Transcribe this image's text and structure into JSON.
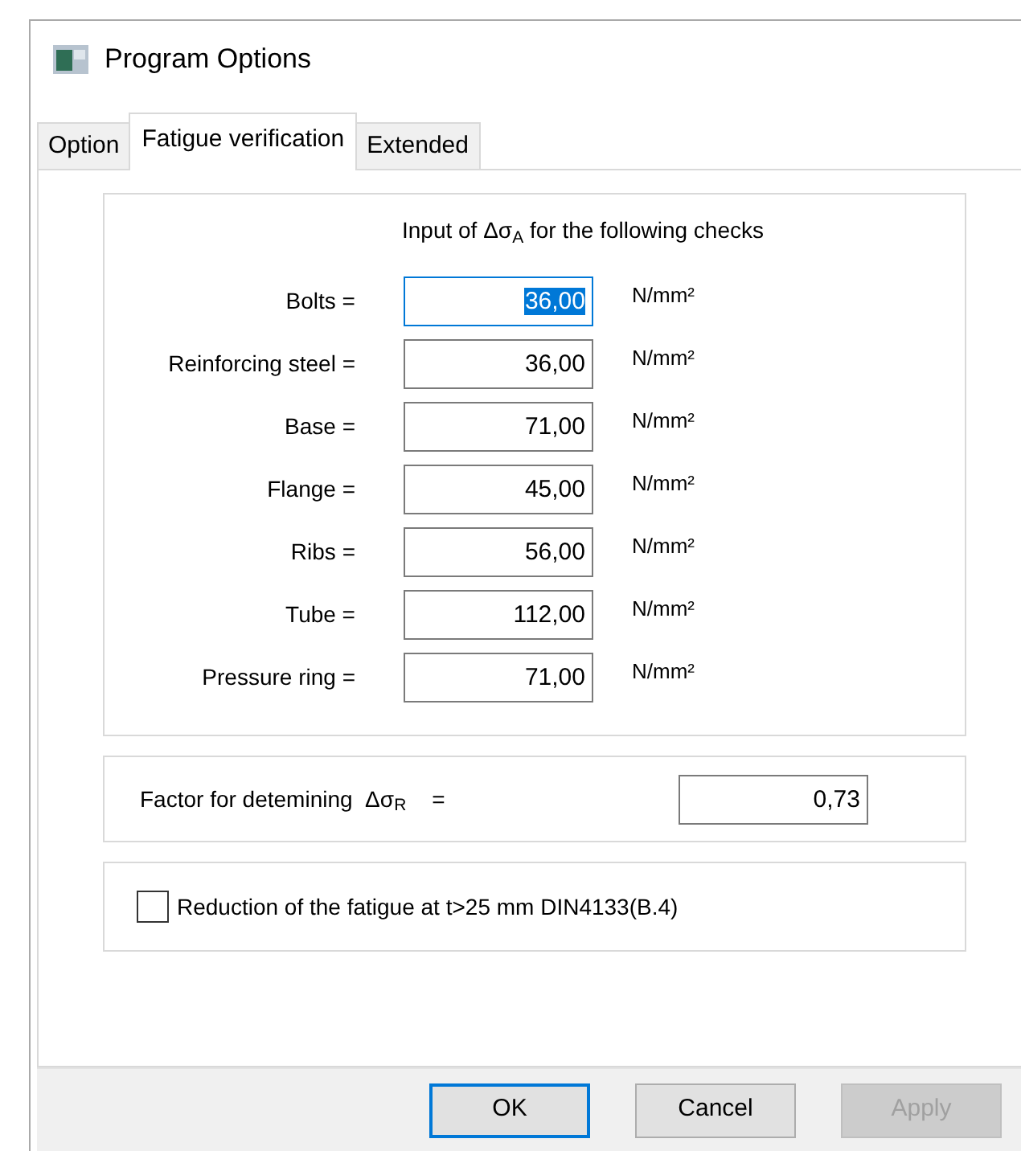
{
  "window": {
    "title": "Program Options"
  },
  "tabs": [
    {
      "label": "Option",
      "selected": false
    },
    {
      "label": "Fatigue verification",
      "selected": true
    },
    {
      "label": "Extended",
      "selected": false
    }
  ],
  "input_group": {
    "heading": "Input of Δσ$_{A}$ for the following checks",
    "fields": [
      {
        "label": "Bolts =",
        "value": "36,00",
        "unit": "N/mm²",
        "focused": true
      },
      {
        "label": "Reinforcing steel =",
        "value": "36,00",
        "unit": "N/mm²",
        "focused": false
      },
      {
        "label": "Base =",
        "value": "71,00",
        "unit": "N/mm²",
        "focused": false
      },
      {
        "label": "Flange =",
        "value": "45,00",
        "unit": "N/mm²",
        "focused": false
      },
      {
        "label": "Ribs =",
        "value": "56,00",
        "unit": "N/mm²",
        "focused": false
      },
      {
        "label": "Tube =",
        "value": "112,00",
        "unit": "N/mm²",
        "focused": false
      },
      {
        "label": "Pressure ring =",
        "value": "71,00",
        "unit": "N/mm²",
        "focused": false
      }
    ]
  },
  "factor": {
    "label": "Factor for detemining  Δσ$_{R}$",
    "equals": "=",
    "value": "0,73"
  },
  "reduction": {
    "label": "Reduction of the fatigue at t>25 mm DIN4133(B.4)",
    "checked": false
  },
  "buttons": [
    {
      "label": "OK",
      "default": true,
      "disabled": false
    },
    {
      "label": "Cancel",
      "default": false,
      "disabled": false
    },
    {
      "label": "Apply",
      "default": false,
      "disabled": true
    }
  ]
}
